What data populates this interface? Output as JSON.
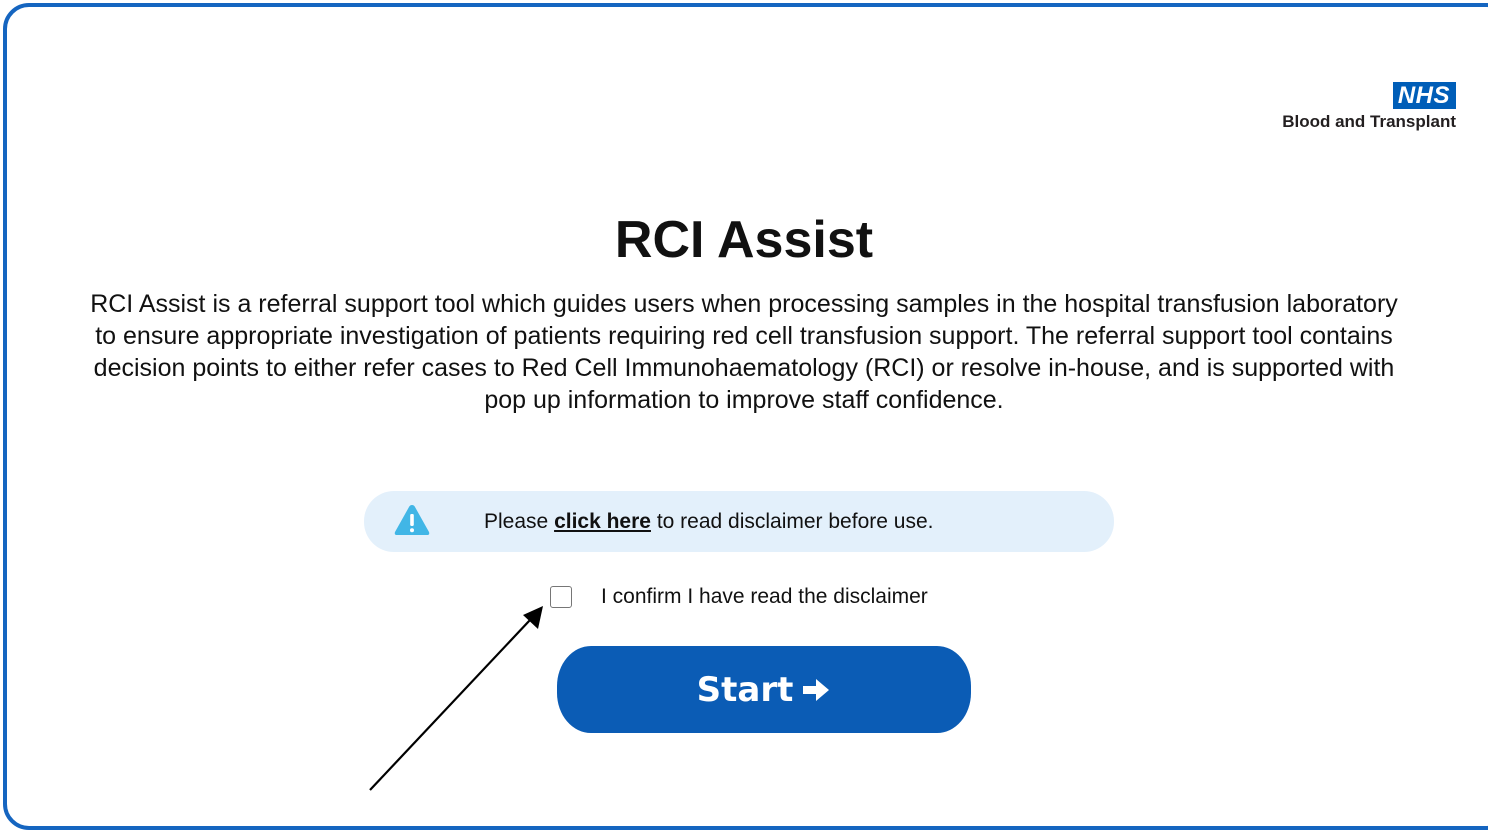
{
  "brand": {
    "nhs_mark": "NHS",
    "org_name": "Blood and Transplant",
    "colors": {
      "nhs_blue": "#005eb8",
      "frame_blue": "#1565c0",
      "button_blue": "#0b5cb5",
      "notice_bg": "#e3f0fb",
      "warning_icon": "#41b6e6"
    }
  },
  "main": {
    "title": "RCI Assist",
    "description": "RCI Assist is a referral support tool which guides users when processing samples in the hospital transfusion laboratory to ensure appropriate investigation of patients requiring red cell transfusion support. The referral support tool contains decision points to either refer cases to Red Cell Immunohaematology (RCI) or resolve in-house, and is supported with pop up information to improve staff confidence."
  },
  "notice": {
    "icon": "warning-triangle-icon",
    "prefix": "Please",
    "link_text": "click here",
    "suffix": "to read disclaimer before use."
  },
  "confirm": {
    "label": "I confirm I have read the disclaimer",
    "checked": false
  },
  "start_button": {
    "label": "Start",
    "icon": "arrow-right-icon"
  },
  "annotation": {
    "icon": "pointer-arrow"
  }
}
